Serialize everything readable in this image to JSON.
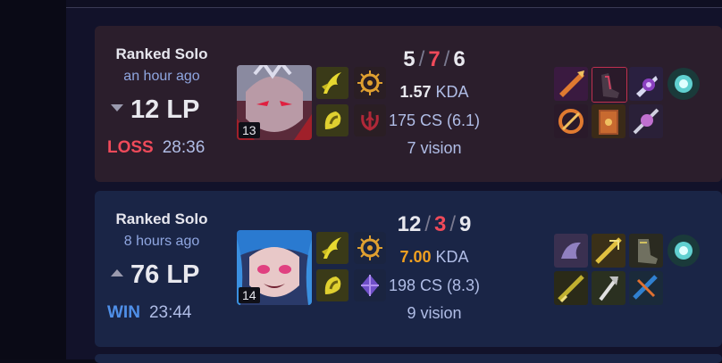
{
  "matches": [
    {
      "queue": "Ranked Solo",
      "time_ago": "an hour ago",
      "lp": "12 LP",
      "result": "LOSS",
      "duration": "28:36",
      "champion_level": "13",
      "kills": "5",
      "deaths": "7",
      "assists": "6",
      "kda_value": "1.57",
      "kda_label": "KDA",
      "cs": "175 CS (6.1)",
      "vision": "7 vision"
    },
    {
      "queue": "Ranked Solo",
      "time_ago": "8 hours ago",
      "lp": "76 LP",
      "result": "WIN",
      "duration": "23:44",
      "champion_level": "14",
      "kills": "12",
      "deaths": "3",
      "assists": "9",
      "kda_value": "7.00",
      "kda_label": "KDA",
      "cs": "198 CS (8.3)",
      "vision": "9 vision"
    }
  ],
  "icons": {
    "match_1_champion": "champion-portrait-icon",
    "match_2_champion": "champion-portrait-icon",
    "summoner_spells": [
      "ghost-spell-icon",
      "cleanse-spell-icon"
    ],
    "rune_primary": "precision-rune-icon",
    "rune_secondary_1": "domination-rune-icon",
    "rune_secondary_2": "sorcery-rune-icon"
  },
  "colors": {
    "loss_card": "#2b1e2c",
    "win_card": "#1a2546",
    "loss_text": "#ef4a5a",
    "win_text": "#4f8fe8",
    "kda_highlight": "#f0a020"
  }
}
